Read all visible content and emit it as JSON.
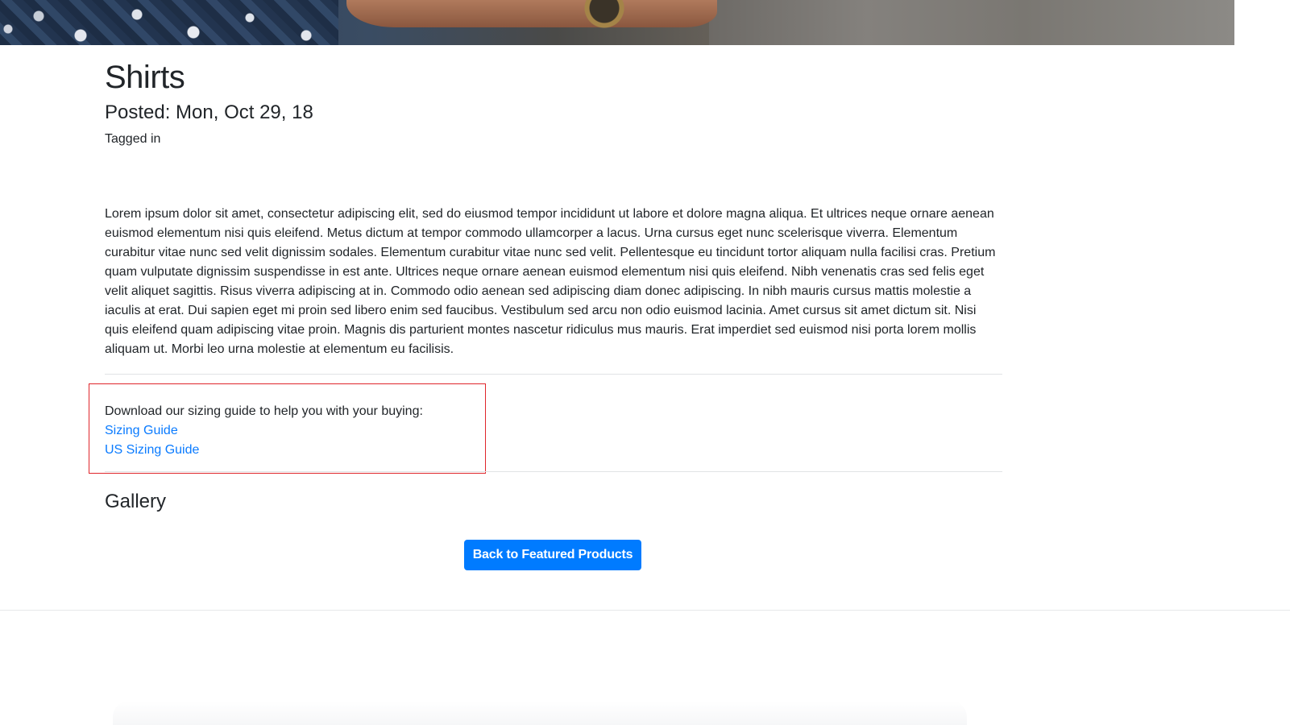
{
  "hero": {
    "image": "man-in-patterned-shirt-with-watch-banner"
  },
  "post": {
    "title": "Shirts",
    "posted": "Posted: Mon, Oct 29, 18",
    "tagged": "Tagged in",
    "body": "Lorem ipsum dolor sit amet, consectetur adipiscing elit, sed do eiusmod tempor incididunt ut labore et dolore magna aliqua. Et ultrices neque ornare aenean euismod elementum nisi quis eleifend. Metus dictum at tempor commodo ullamcorper a lacus. Urna cursus eget nunc scelerisque viverra. Elementum curabitur vitae nunc sed velit dignissim sodales. Elementum curabitur vitae nunc sed velit. Pellentesque eu tincidunt tortor aliquam nulla facilisi cras. Pretium quam vulputate dignissim suspendisse in est ante. Ultrices neque ornare aenean euismod elementum nisi quis eleifend. Nibh venenatis cras sed felis eget velit aliquet sagittis. Risus viverra adipiscing at in. Commodo odio aenean sed adipiscing diam donec adipiscing. In nibh mauris cursus mattis molestie a iaculis at erat. Dui sapien eget mi proin sed libero enim sed faucibus. Vestibulum sed arcu non odio euismod lacinia. Amet cursus sit amet dictum sit. Nisi quis eleifend quam adipiscing vitae proin. Magnis dis parturient montes nascetur ridiculus mus mauris. Erat imperdiet sed euismod nisi porta lorem mollis aliquam ut. Morbi leo urna molestie at elementum eu facilisis."
  },
  "downloads": {
    "intro": "Download our sizing guide to help you with your buying:",
    "links": [
      "Sizing Guide",
      "US Sizing Guide"
    ]
  },
  "gallery": {
    "heading": "Gallery"
  },
  "actions": {
    "back_label": "Back to Featured Products"
  },
  "colors": {
    "link": "#0a7bff",
    "button": "#007bff",
    "highlight_border": "#e0262b"
  }
}
